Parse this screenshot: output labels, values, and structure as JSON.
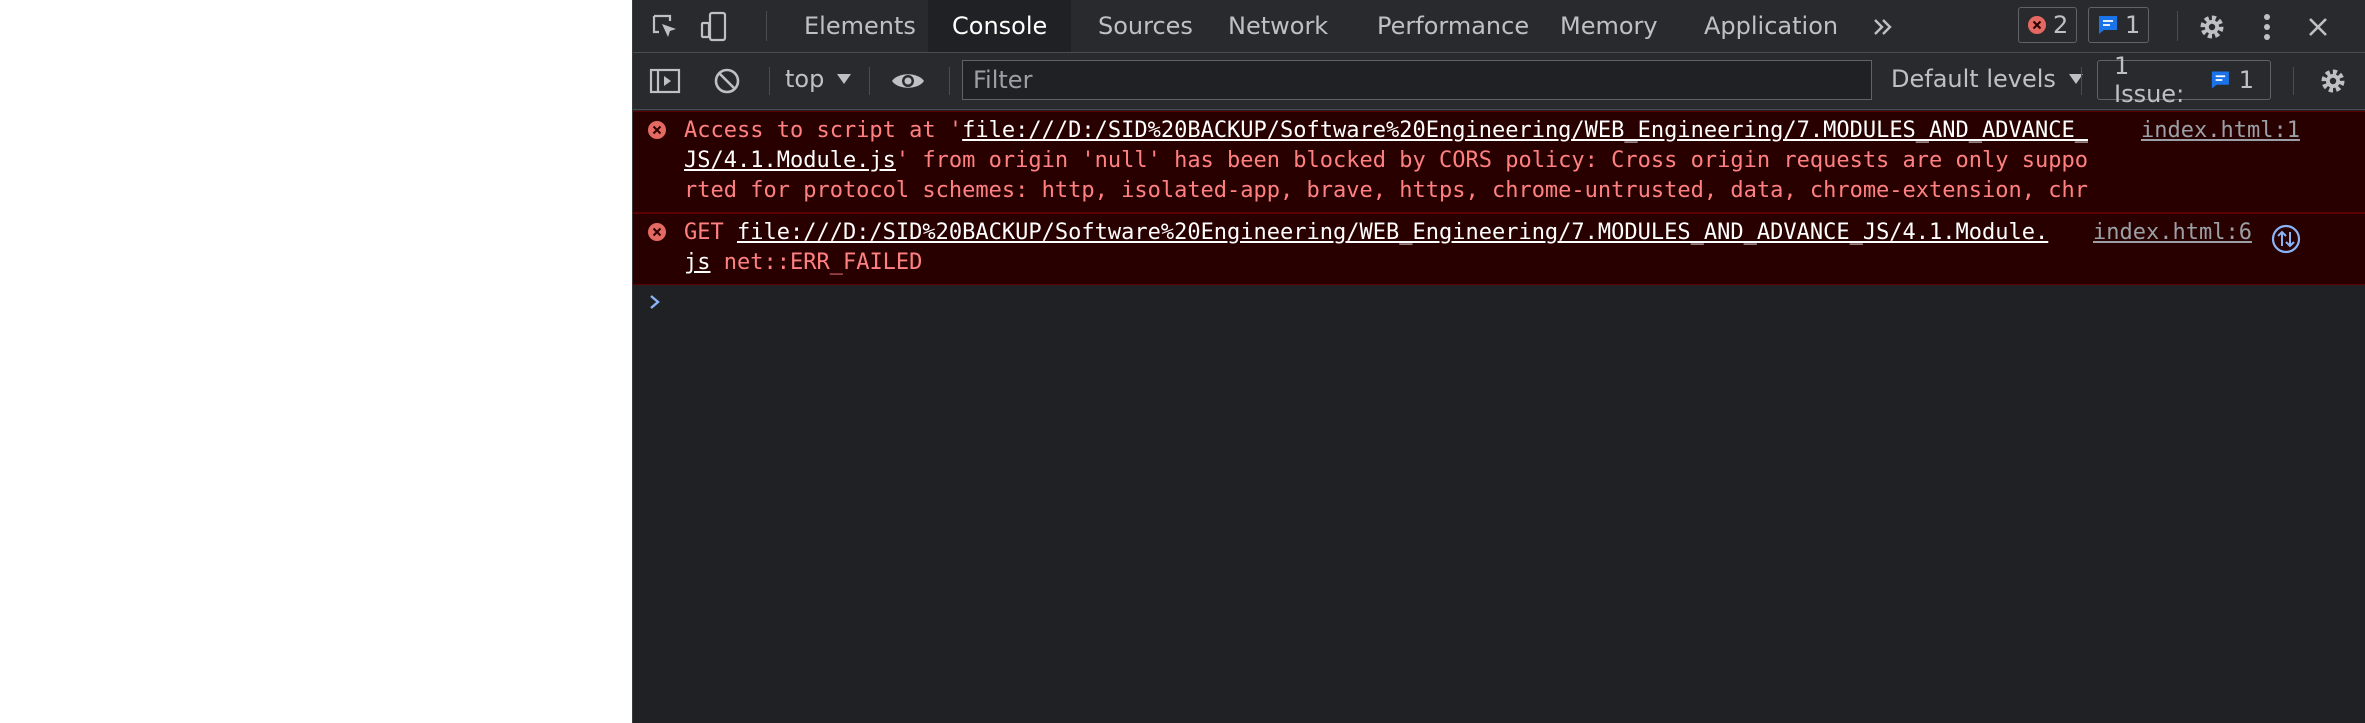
{
  "devtools": {
    "tabs": [
      {
        "label": "Elements"
      },
      {
        "label": "Console"
      },
      {
        "label": "Sources"
      },
      {
        "label": "Network"
      },
      {
        "label": "Performance"
      },
      {
        "label": "Memory"
      },
      {
        "label": "Application"
      }
    ],
    "active_tab": "Console",
    "error_count": "2",
    "message_count": "1",
    "icons": [
      "inspect-element-icon",
      "device-toolbar-icon",
      "more-tabs-icon",
      "error-icon",
      "message-icon",
      "settings-icon",
      "kebab-menu-icon",
      "close-icon"
    ]
  },
  "console_toolbar": {
    "context": "top",
    "filter_placeholder": "Filter",
    "levels": "Default levels",
    "issues_label": "1 Issue:",
    "issues_count": "1",
    "icons": [
      "sidebar-toggle-icon",
      "clear-console-icon",
      "chevron-down-icon",
      "eye-icon",
      "settings-icon"
    ]
  },
  "messages": [
    {
      "level": "error",
      "prefix": "Access to script at '",
      "url": "file:///D:/SID%20BACKUP/Software%20Engineering/WEB_Engineering/7.MODULES_AND_ADVANCE_JS/4.1.Module.js",
      "suffix": "' from origin 'null' has been blocked by CORS policy: Cross origin requests are only supported for protocol schemes: http, isolated-app, brave, https, chrome-untrusted, data, chrome-extension, chrome.",
      "source": "index.html:1"
    },
    {
      "level": "error",
      "prefix": "GET ",
      "url": "file:///D:/SID%20BACKUP/Software%20Engineering/WEB_Engineering/7.MODULES_AND_ADVANCE_JS/4.1.Module.js",
      "suffix": " net::ERR_FAILED",
      "source": "index.html:6"
    }
  ],
  "colors": {
    "panel_bg": "#202124",
    "toolbar_bg": "#292a2d",
    "error_bg": "#290000",
    "error_text": "#ff8080",
    "error_icon": "#e46962",
    "link_blue": "#8ab4f8",
    "badge_blue": "#1a73e8"
  }
}
